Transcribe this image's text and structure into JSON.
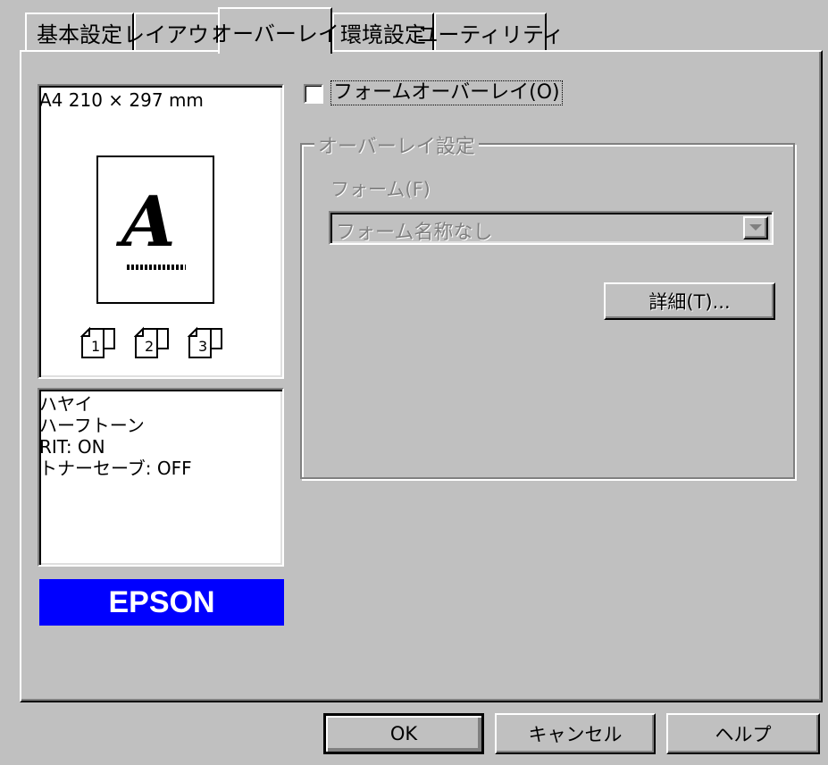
{
  "tabs": [
    {
      "label": "基本設定",
      "active": false
    },
    {
      "label": "レイアウト",
      "active": false
    },
    {
      "label": "オーバーレイ",
      "active": true
    },
    {
      "label": "環境設定",
      "active": false
    },
    {
      "label": "ユーティリティ",
      "active": false
    }
  ],
  "preview": {
    "paper_size": "A4 210 × 297 mm",
    "page_letter": "A",
    "copy_icons": [
      "1",
      "2",
      "3"
    ]
  },
  "settings_summary": {
    "lines": [
      "ハヤイ",
      "ハーフトーン",
      "RIT: ON",
      "トナーセーブ: OFF"
    ]
  },
  "brand": {
    "label": "EPSON",
    "color": "#0000ff"
  },
  "form_overlay": {
    "checkbox_label": "フォームオーバーレイ(O)",
    "checked": false
  },
  "overlay_settings": {
    "group_title": "オーバーレイ設定",
    "form_label": "フォーム(F)",
    "form_value": "フォーム名称なし",
    "details_button": "詳細(T)..."
  },
  "footer": {
    "ok": "OK",
    "cancel": "キャンセル",
    "help": "ヘルプ"
  }
}
